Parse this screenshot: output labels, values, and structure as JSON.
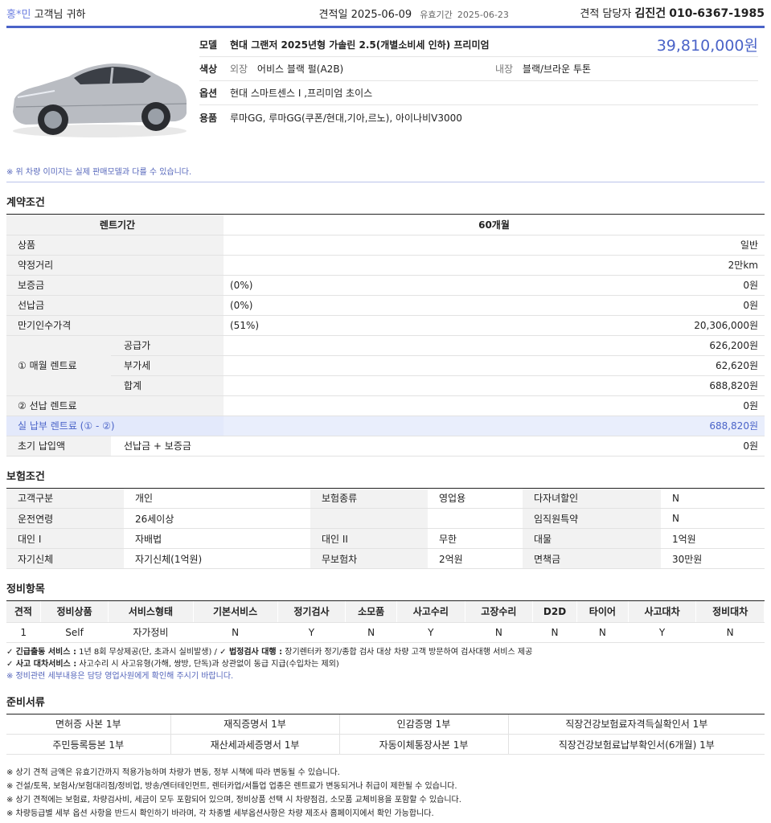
{
  "header": {
    "customer_name": "홍*민",
    "customer_suffix": "고객님 귀하",
    "quote_date_label": "견적일",
    "quote_date": "2025-06-09",
    "valid_label": "유효기간",
    "valid_date": "2025-06-23",
    "manager_label": "견적 담당자",
    "manager_name": "김진건",
    "manager_phone": "010-6367-1985"
  },
  "car": {
    "model_label": "모델",
    "model": "현대 그랜저 2025년형 가솔린 2.5(개별소비세 인하) 프리미엄",
    "price": "39,810,000원",
    "color_label": "색상",
    "exterior_label": "외장",
    "exterior": "어비스 블랙 펄(A2B)",
    "interior_label": "내장",
    "interior": "블랙/브라운 투톤",
    "option_label": "옵션",
    "options": "현대 스마트센스 I ,프리미엄 초이스",
    "goods_label": "용품",
    "goods": "루마GG, 루마GG(쿠폰/현대,기아,르노), 아이나비V3000",
    "image_note": "※ 위 차량 이미지는 실제 판매모델과 다를 수 있습니다."
  },
  "contract": {
    "title": "계약조건",
    "term_label": "렌트기간",
    "term": "60개월",
    "rows": [
      {
        "label": "상품",
        "pct": "",
        "value": "일반"
      },
      {
        "label": "약정거리",
        "pct": "",
        "value": "2만km"
      },
      {
        "label": "보증금",
        "pct": "(0%)",
        "value": "0원"
      },
      {
        "label": "선납금",
        "pct": "(0%)",
        "value": "0원"
      },
      {
        "label": "만기인수가격",
        "pct": "(51%)",
        "value": "20,306,000원"
      }
    ],
    "monthly_label": "① 매월 렌트료",
    "monthly": [
      {
        "label": "공급가",
        "value": "626,200원"
      },
      {
        "label": "부가세",
        "value": "62,620원"
      },
      {
        "label": "합계",
        "value": "688,820원"
      }
    ],
    "prepaid_label": "② 선납 렌트료",
    "prepaid_value": "0원",
    "actual_label": "실 납부 렌트료 (① - ②)",
    "actual_value": "688,820원",
    "initial_label": "초기 납입액",
    "initial_desc": "선납금 + 보증금",
    "initial_value": "0원"
  },
  "insurance": {
    "title": "보험조건",
    "rows": [
      [
        "고객구분",
        "개인",
        "보험종류",
        "영업용",
        "다자녀할인",
        "N"
      ],
      [
        "운전연령",
        "26세이상",
        "",
        "",
        "임직원특약",
        "N"
      ],
      [
        "대인 I",
        "자배법",
        "대인 II",
        "무한",
        "대물",
        "1억원"
      ],
      [
        "자기신체",
        "자기신체(1억원)",
        "무보험차",
        "2억원",
        "면책금",
        "30만원"
      ]
    ]
  },
  "maintenance": {
    "title": "정비항목",
    "headers": [
      "견적",
      "정비상품",
      "서비스형태",
      "기본서비스",
      "정기검사",
      "소모품",
      "사고수리",
      "고장수리",
      "D2D",
      "타이어",
      "사고대차",
      "정비대차"
    ],
    "row": [
      "1",
      "Self",
      "자가정비",
      "N",
      "Y",
      "N",
      "Y",
      "N",
      "N",
      "N",
      "Y",
      "N"
    ],
    "note1_check": "✓",
    "note1_b1": "긴급출동 서비스 :",
    "note1_t1": " 1년 8회 무상제공(단, 초과시 실비발생) / ",
    "note1_b2": "✓ 법정검사 대행 :",
    "note1_t2": " 장기렌터카 정기/종합 검사 대상 차량 고객 방문하여 검사대행 서비스 제공",
    "note2_b": "✓ 사고 대차서비스 :",
    "note2_t": " 사고수리 시 사고유형(가해, 쌍방, 단독)과 상관없이 동급 지급(수입차는 제외)",
    "note3": "※ 정비관련 세부내용은 담당 영업사원에게 확인해 주시기 바랍니다."
  },
  "documents": {
    "title": "준비서류",
    "rows": [
      [
        "면허증 사본 1부",
        "재직증명서 1부",
        "인감증명 1부",
        "직장건강보험료자격득실확인서 1부"
      ],
      [
        "주민등록등본 1부",
        "재산세과세증명서 1부",
        "자동이체통장사본 1부",
        "직장건강보험료납부확인서(6개월) 1부"
      ]
    ]
  },
  "footer": [
    "※ 상기 견적 금액은 유효기간까지 적용가능하며 차량가 변동, 정부 시책에 따라 변동될 수 있습니다.",
    "※ 건설/토목, 보험사/보험대리점/정비업, 방송/엔터테인먼트, 렌터카업/서틀업 업종은 렌트료가 변동되거나 취급이 제한될 수 있습니다.",
    "※ 상기 견적에는 보험료, 차량검사비, 세금이 모두 포함되어 있으며, 정비상품 선택 시 차량점검, 소모품 교체비용을 포함할 수 있습니다.",
    "※ 차량등급별 세부 옵션 사항을 반드시 확인하기 바라며, 각 차종별 세부옵션사항은 차량 제조사 홈페이지에서 확인 가능합니다."
  ],
  "colors": {
    "accent": "#4a63c8",
    "label_bg": "#f2f2f2",
    "highlight_bg": "#e9eefc"
  }
}
